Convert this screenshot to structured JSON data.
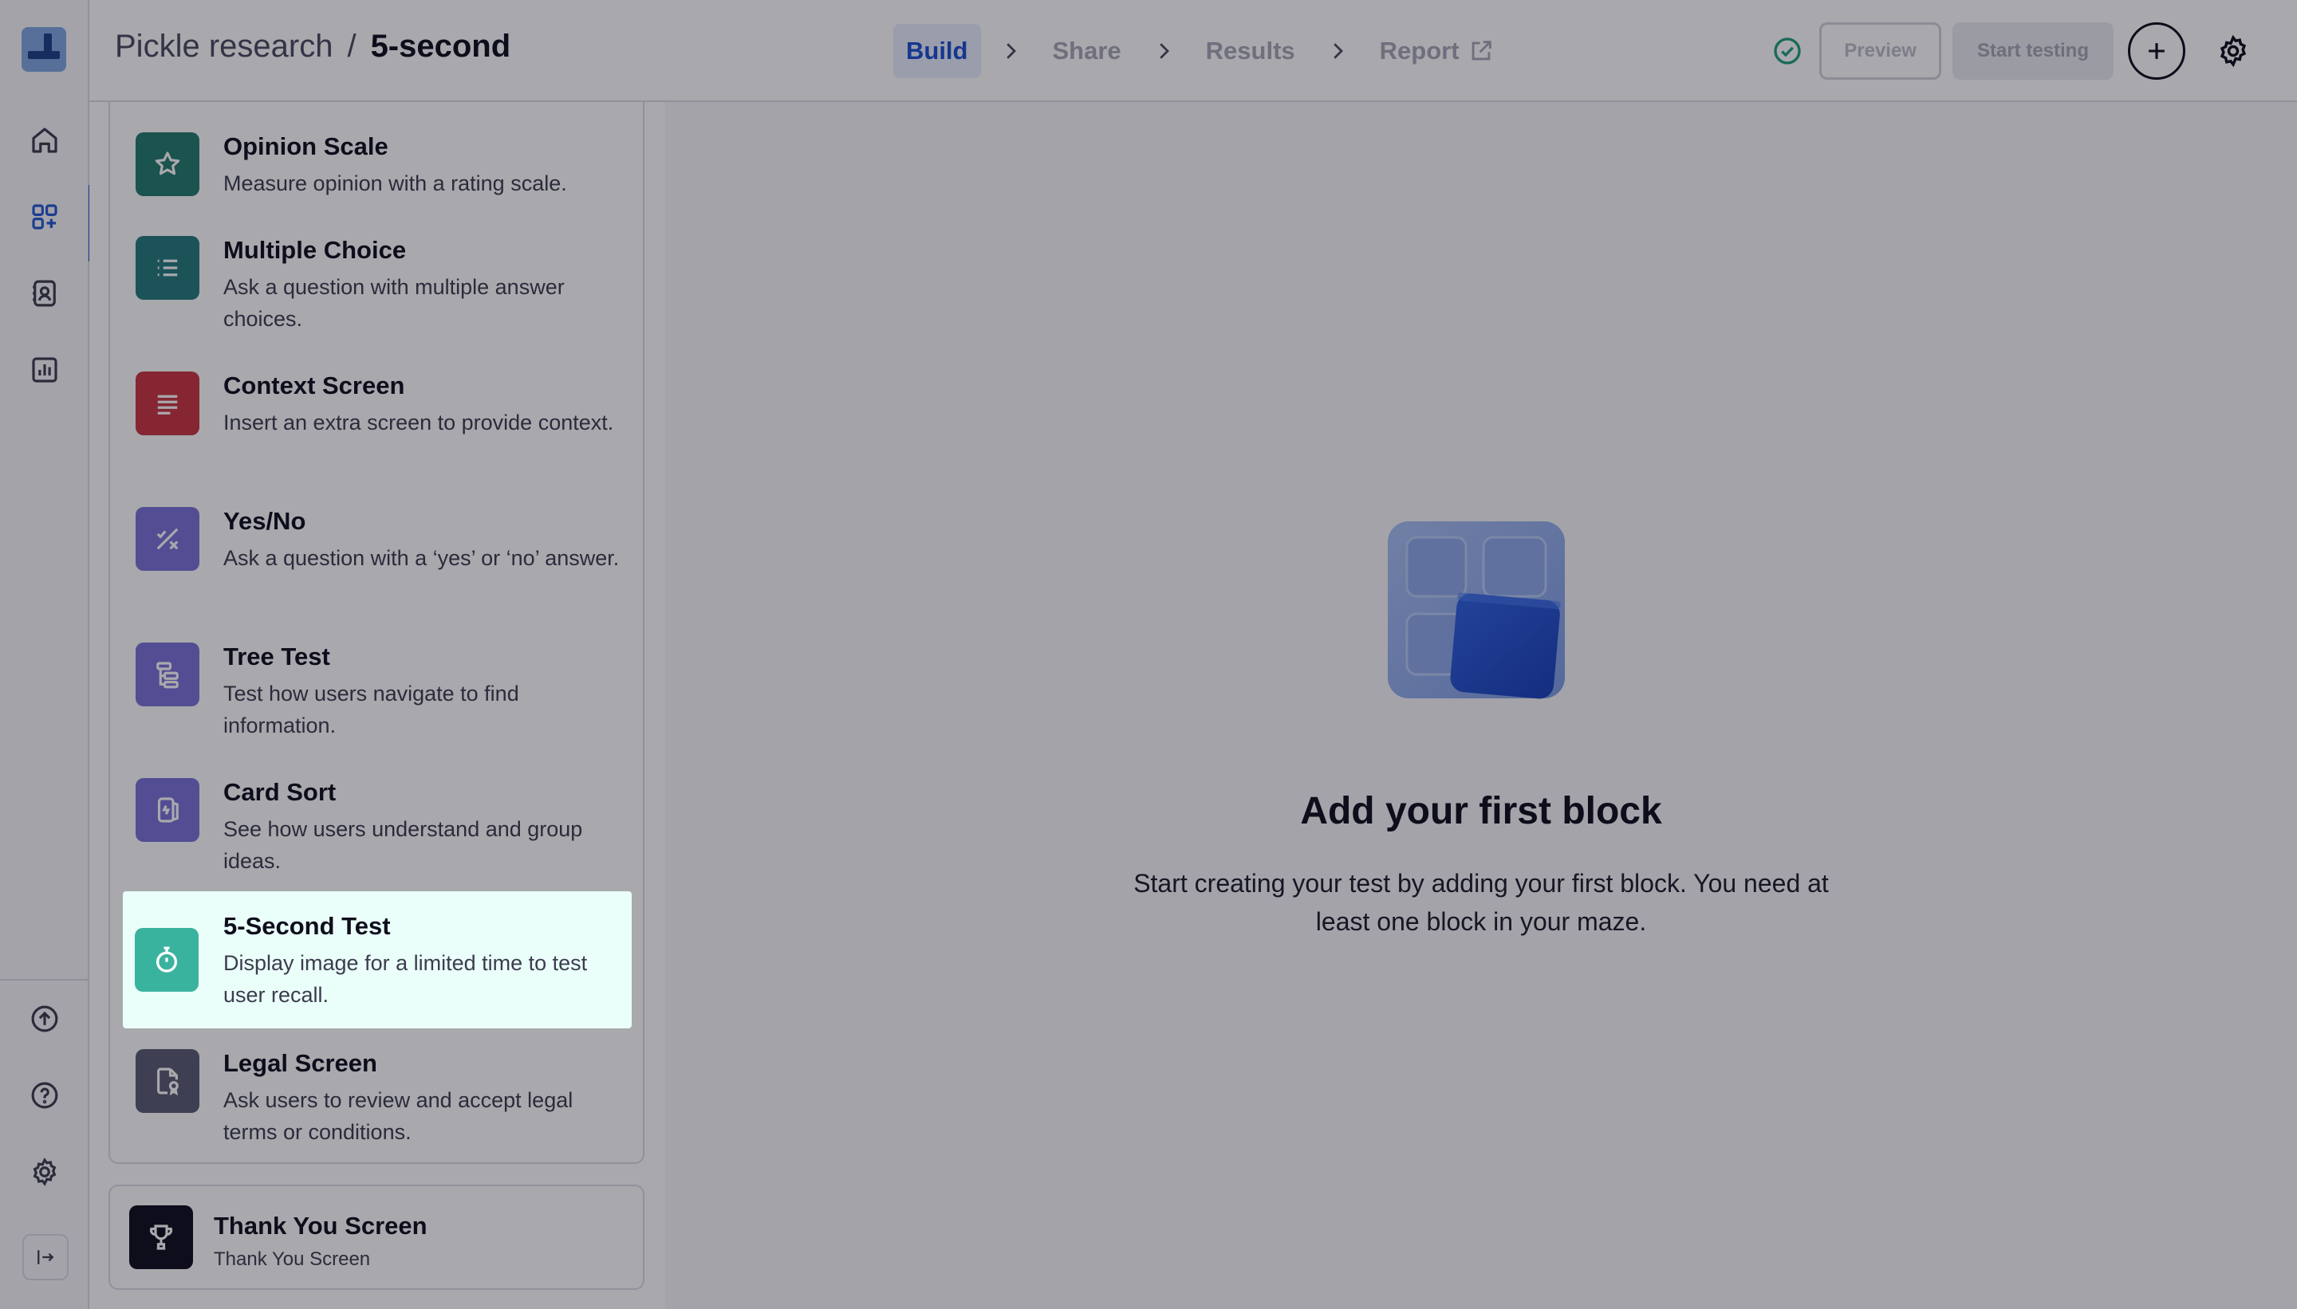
{
  "app": {
    "breadcrumb": {
      "project": "Pickle research",
      "separator": "/",
      "current": "5-second"
    }
  },
  "steps": [
    {
      "label": "Build",
      "active": true
    },
    {
      "label": "Share",
      "active": false
    },
    {
      "label": "Results",
      "active": false
    },
    {
      "label": "Report",
      "active": false,
      "icon": "external-link-icon"
    }
  ],
  "header_actions": {
    "status_icon": "check-circle-icon",
    "preview_label": "Preview",
    "start_label": "Start testing",
    "add_icon": "plus-icon",
    "settings_icon": "gear-icon"
  },
  "rail": {
    "top_icons": [
      "home-icon",
      "grid-icon",
      "contacts-icon",
      "chart-icon"
    ],
    "bottom_icons": [
      "upload-icon",
      "help-icon",
      "settings-icon",
      "collapse-icon"
    ]
  },
  "blocks": [
    {
      "title": "Opinion Scale",
      "desc": "Measure opinion with a rating scale.",
      "icon": "star-icon",
      "color": "#237a6b"
    },
    {
      "title": "Multiple Choice",
      "desc": "Ask a question with multiple answer choices.",
      "icon": "list-icon",
      "color": "#237a7a"
    },
    {
      "title": "Context Screen",
      "desc": "Insert an extra screen to provide context.",
      "icon": "text-lines-icon",
      "color": "#c8343f"
    },
    {
      "title": "Yes/No",
      "desc": "Ask a question with a ‘yes’ or ‘no’ answer.",
      "icon": "yes-no-icon",
      "color": "#7b71d6"
    },
    {
      "title": "Tree Test",
      "desc": "Test how users navigate to find information.",
      "icon": "tree-icon",
      "color": "#7b71d6"
    },
    {
      "title": "Card Sort",
      "desc": "See how users understand and group ideas.",
      "icon": "cards-icon",
      "color": "#7b71d6"
    },
    {
      "title": "5-Second Test",
      "desc": "Display image for a limited time to test user recall.",
      "icon": "stopwatch-icon",
      "color": "#3ab39e",
      "highlighted": true
    },
    {
      "title": "Legal Screen",
      "desc": "Ask users to review and accept legal terms or conditions.",
      "icon": "legal-doc-icon",
      "color": "#5c5c72"
    }
  ],
  "thank_you": {
    "title": "Thank You Screen",
    "subtitle": "Thank You Screen",
    "icon": "trophy-icon",
    "color": "#0e0e1b"
  },
  "empty_state": {
    "title": "Add your first block",
    "description": "Start creating your test by adding your first block. You need at least one block in your maze.",
    "illustration": "blocks-illustration"
  },
  "colors": {
    "accent": "#1a4fd0",
    "overlay": "rgba(14,14,27,0.36)",
    "highlight": "#eafffa"
  }
}
